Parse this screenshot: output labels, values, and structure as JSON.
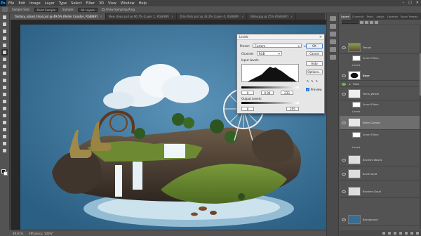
{
  "menu": {
    "logo": "Ps",
    "items": [
      "File",
      "Edit",
      "Image",
      "Layer",
      "Type",
      "Select",
      "Filter",
      "3D",
      "View",
      "Window",
      "Help"
    ],
    "window_controls": [
      "–",
      "□",
      "✕"
    ]
  },
  "options_bar": {
    "sample_size_label": "Sample Size:",
    "sample_size_value": "Point Sample",
    "sample_label": "Sample:",
    "sample_value": "All Layers",
    "show_ring_label": "Show Sampling Ring"
  },
  "tabs": [
    {
      "label": "fantasy_island_Final.psd @ 49.6% (Roller Coaster, RGB/8#)",
      "active": true
    },
    {
      "label": "New steps.psd @ 66.7% (Layer 1, RGB/8#)",
      "active": false
    },
    {
      "label": "Dino Park.psd @ 33.3% (Layer 4, RGB/8#)",
      "active": false
    },
    {
      "label": "Valley.jpg @ 25% (RGB/8#)",
      "active": false
    }
  ],
  "status_bar": {
    "zoom": "49.61%",
    "doc_info": "Efficiency: 100%*"
  },
  "levels_dialog": {
    "title": "Levels",
    "preset_label": "Preset:",
    "preset_value": "Custom",
    "channel_label": "Channel:",
    "channel_value": "RGB",
    "input_levels_label": "Input Levels:",
    "input_values": [
      "0",
      "0.94",
      "233"
    ],
    "output_levels_label": "Output Levels:",
    "output_values": [
      "0",
      "255"
    ],
    "buttons": {
      "ok": "OK",
      "cancel": "Cancel",
      "auto": "Auto",
      "options": "Options..."
    },
    "preview_label": "Preview"
  },
  "panel_tabs": [
    "Layers",
    "Channels",
    "Paths",
    "Adjust",
    "Libraries",
    "Brush Presets"
  ],
  "layers": [
    {
      "name": "Terrain",
      "sub": "Smart Filters"
    },
    {
      "name": "Levels"
    },
    {
      "name": "Base"
    },
    {
      "name": "Trees"
    },
    {
      "name": "Ferris_Wheel",
      "sub": "Smart Filters"
    },
    {
      "name": "Levels"
    },
    {
      "name": "Roller Coaster",
      "sub": "Smart Filters",
      "selected": true
    },
    {
      "name": "Levels"
    },
    {
      "name": "Brushes Waves"
    },
    {
      "name": "Brush sand"
    },
    {
      "name": "Brushes Cloud"
    },
    {
      "name": "Background"
    }
  ]
}
